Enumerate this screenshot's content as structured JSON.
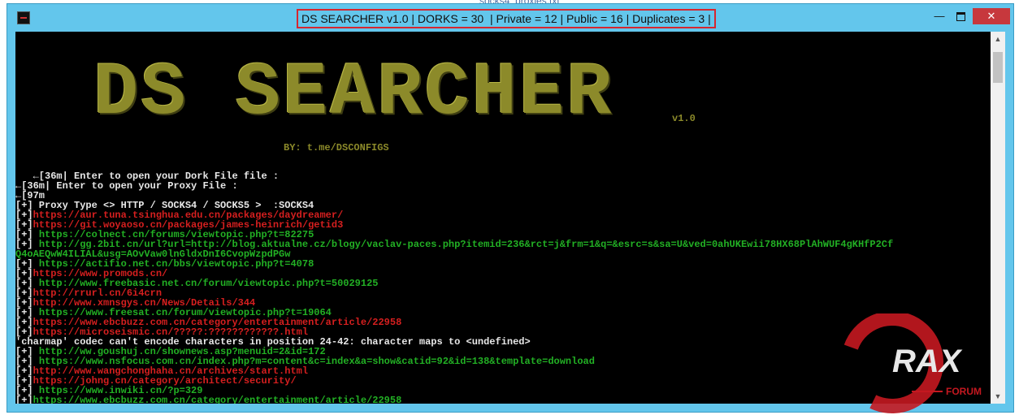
{
  "background_tab": {
    "label": "socks4_proxies.txt"
  },
  "window": {
    "title": "DS SEARCHER v1.0 | DORKS = 30  | Private = 12 | Public = 16 | Duplicates = 3 |",
    "controls": {
      "minimize": "—",
      "close": "✕"
    }
  },
  "console": {
    "logo_text": "DS SEARCHER",
    "version": "v1.0",
    "byline": "BY: t.me/DSCONFIGS",
    "lines": [
      {
        "text": "   ←[36m| Enter to open your Dork File file :",
        "color": "w"
      },
      {
        "text": "←[36m| Enter to open your Proxy File :",
        "color": "w"
      },
      {
        "text": "←[97m",
        "color": "w"
      },
      {
        "text": "[+] Proxy Type <> HTTP / SOCKS4 / SOCKS5 >  :SOCKS4",
        "color": "w"
      },
      {
        "prefix": "[+]",
        "text": "https://aur.tuna.tsinghua.edu.cn/packages/daydreamer/",
        "color": "r"
      },
      {
        "prefix": "[+]",
        "text": "https://git.woyaoso.cn/packages/james-heinrich/getid3",
        "color": "r"
      },
      {
        "prefix": "[+] ",
        "text": "https://colnect.cn/forums/viewtopic.php?t=82275",
        "color": "g"
      },
      {
        "prefix": "[+] ",
        "text": "http://gg.2bit.cn/url?url=http://blog.aktualne.cz/blogy/vaclav-paces.php?itemid=236&rct=j&frm=1&q=&esrc=s&sa=U&ved=0ahUKEwii78HX68PlAhWUF4gKHfP2Cf",
        "color": "g"
      },
      {
        "text": "Q4oAEQwW4ILIAL&usg=AOvVaw0lnGldxDnI6CvopWzpdPGw",
        "color": "g"
      },
      {
        "prefix": "[+] ",
        "text": "https://actifio.net.cn/bbs/viewtopic.php?t=4078",
        "color": "g"
      },
      {
        "prefix": "[+]",
        "text": "https://www.promods.cn/",
        "color": "r"
      },
      {
        "prefix": "[+] ",
        "text": "http://www.freebasic.net.cn/forum/viewtopic.php?t=50029125",
        "color": "g"
      },
      {
        "prefix": "[+]",
        "text": "http://rrurl.cn/6i4crn",
        "color": "r"
      },
      {
        "prefix": "[+]",
        "text": "http://www.xmnsgys.cn/News/Details/344",
        "color": "r"
      },
      {
        "prefix": "[+] ",
        "text": "https://www.freesat.cn/forum/viewtopic.php?t=19064",
        "color": "g"
      },
      {
        "prefix": "[+]",
        "text": "https://www.ebcbuzz.com.cn/category/entertainment/article/22958",
        "color": "r"
      },
      {
        "prefix": "[+]",
        "text": "https://microseismic.cn/?????:????????????.html",
        "color": "r"
      },
      {
        "text": "'charmap' codec can't encode characters in position 24-42: character maps to <undefined>",
        "color": "w"
      },
      {
        "prefix": "[+] ",
        "text": "http://ww.goushuj.cn/shownews.asp?menuid=2&id=172",
        "color": "g"
      },
      {
        "prefix": "[+] ",
        "text": "https://www.nsfocus.com.cn/index.php?m=content&c=index&a=show&catid=92&id=138&template=download",
        "color": "g"
      },
      {
        "prefix": "[+]",
        "text": "http://www.wangchonghaha.cn/archives/start.html",
        "color": "r"
      },
      {
        "prefix": "[+]",
        "text": "https://johng.cn/category/architect/security/",
        "color": "r"
      },
      {
        "prefix": "[+] ",
        "text": "https://www.inwiki.cn/?p=329",
        "color": "g"
      },
      {
        "prefix": "[+]",
        "text": "https://www.ebcbuzz.com.cn/category/entertainment/article/22958",
        "color": "g"
      }
    ]
  },
  "watermark": {
    "brand": "RAX",
    "sub": "FORUM"
  },
  "colors": {
    "title_highlight": "#d6262f",
    "window_frame": "#63c6ec",
    "logo": "#8c8a2a",
    "green": "#22b024",
    "red": "#d61f1f"
  }
}
